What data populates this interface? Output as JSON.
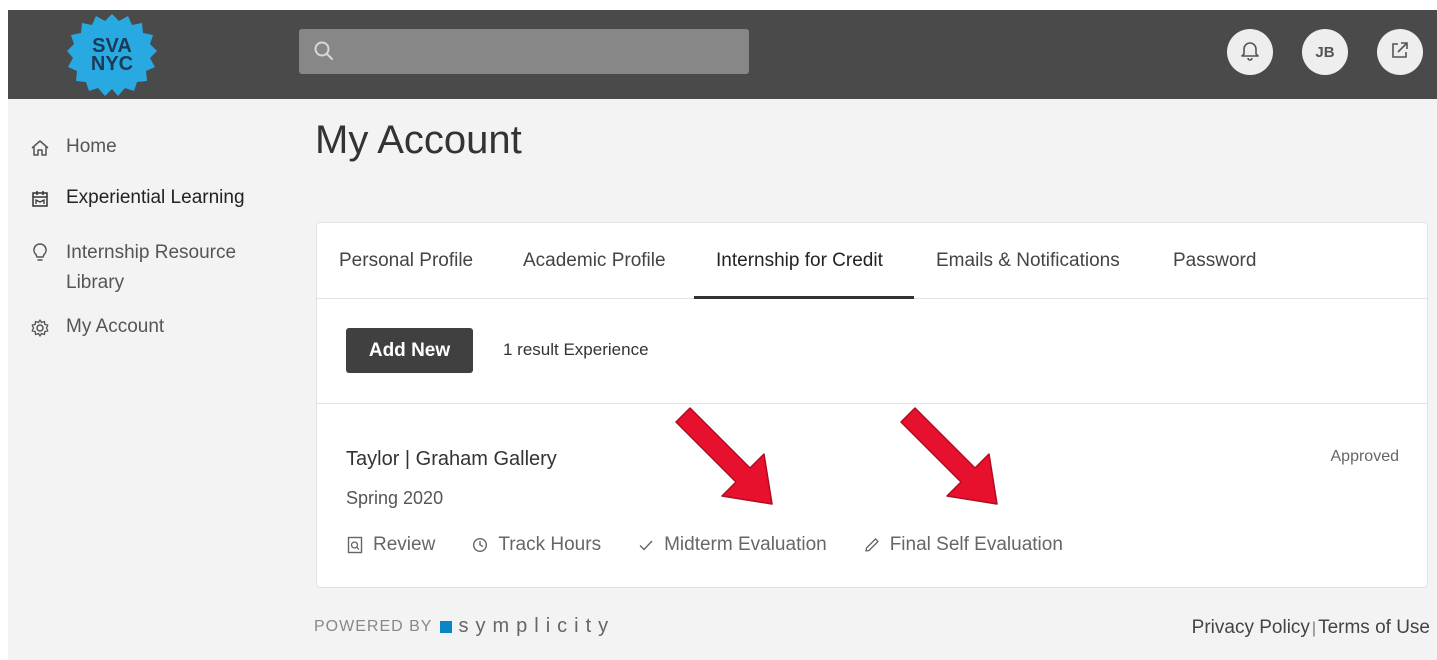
{
  "brand": {
    "logo_text_line1": "SVA",
    "logo_text_line2": "NYC",
    "logo_color": "#29a9e1"
  },
  "header": {
    "search": {
      "placeholder": ""
    },
    "buttons": {
      "notifications_icon": "bell-icon",
      "user_initials": "JB",
      "external_icon": "external-link-icon"
    }
  },
  "sidebar": {
    "items": [
      {
        "label": "Home",
        "icon": "home-icon",
        "active": false
      },
      {
        "label": "Experiential Learning",
        "icon": "calendar-icon",
        "active": true
      },
      {
        "label": "Internship Resource Library",
        "icon": "lightbulb-icon",
        "active": false
      },
      {
        "label": "My Account",
        "icon": "gear-icon",
        "active": false
      }
    ]
  },
  "main": {
    "title": "My Account",
    "tabs": [
      {
        "label": "Personal Profile",
        "active": false
      },
      {
        "label": "Academic Profile",
        "active": false
      },
      {
        "label": "Internship for Credit",
        "active": true
      },
      {
        "label": "Emails & Notifications",
        "active": false
      },
      {
        "label": "Password",
        "active": false
      }
    ],
    "toolbar": {
      "add_label": "Add New",
      "result_text": "1 result Experience"
    },
    "entry": {
      "title": "Taylor | Graham Gallery",
      "term": "Spring 2020",
      "status": "Approved",
      "actions": [
        {
          "label": "Review",
          "icon": "document-search-icon"
        },
        {
          "label": "Track Hours",
          "icon": "clock-icon"
        },
        {
          "label": "Midterm Evaluation",
          "icon": "check-icon"
        },
        {
          "label": "Final Self Evaluation",
          "icon": "pencil-icon"
        }
      ]
    }
  },
  "footer": {
    "powered_by": "POWERED BY",
    "powered_brand": "symplicity",
    "privacy": "Privacy Policy",
    "separator": "|",
    "terms": "Terms of Use"
  },
  "colors": {
    "topbar": "#4a4a4b",
    "accent_arrow": "#e8112d",
    "button_dark": "#404041"
  }
}
